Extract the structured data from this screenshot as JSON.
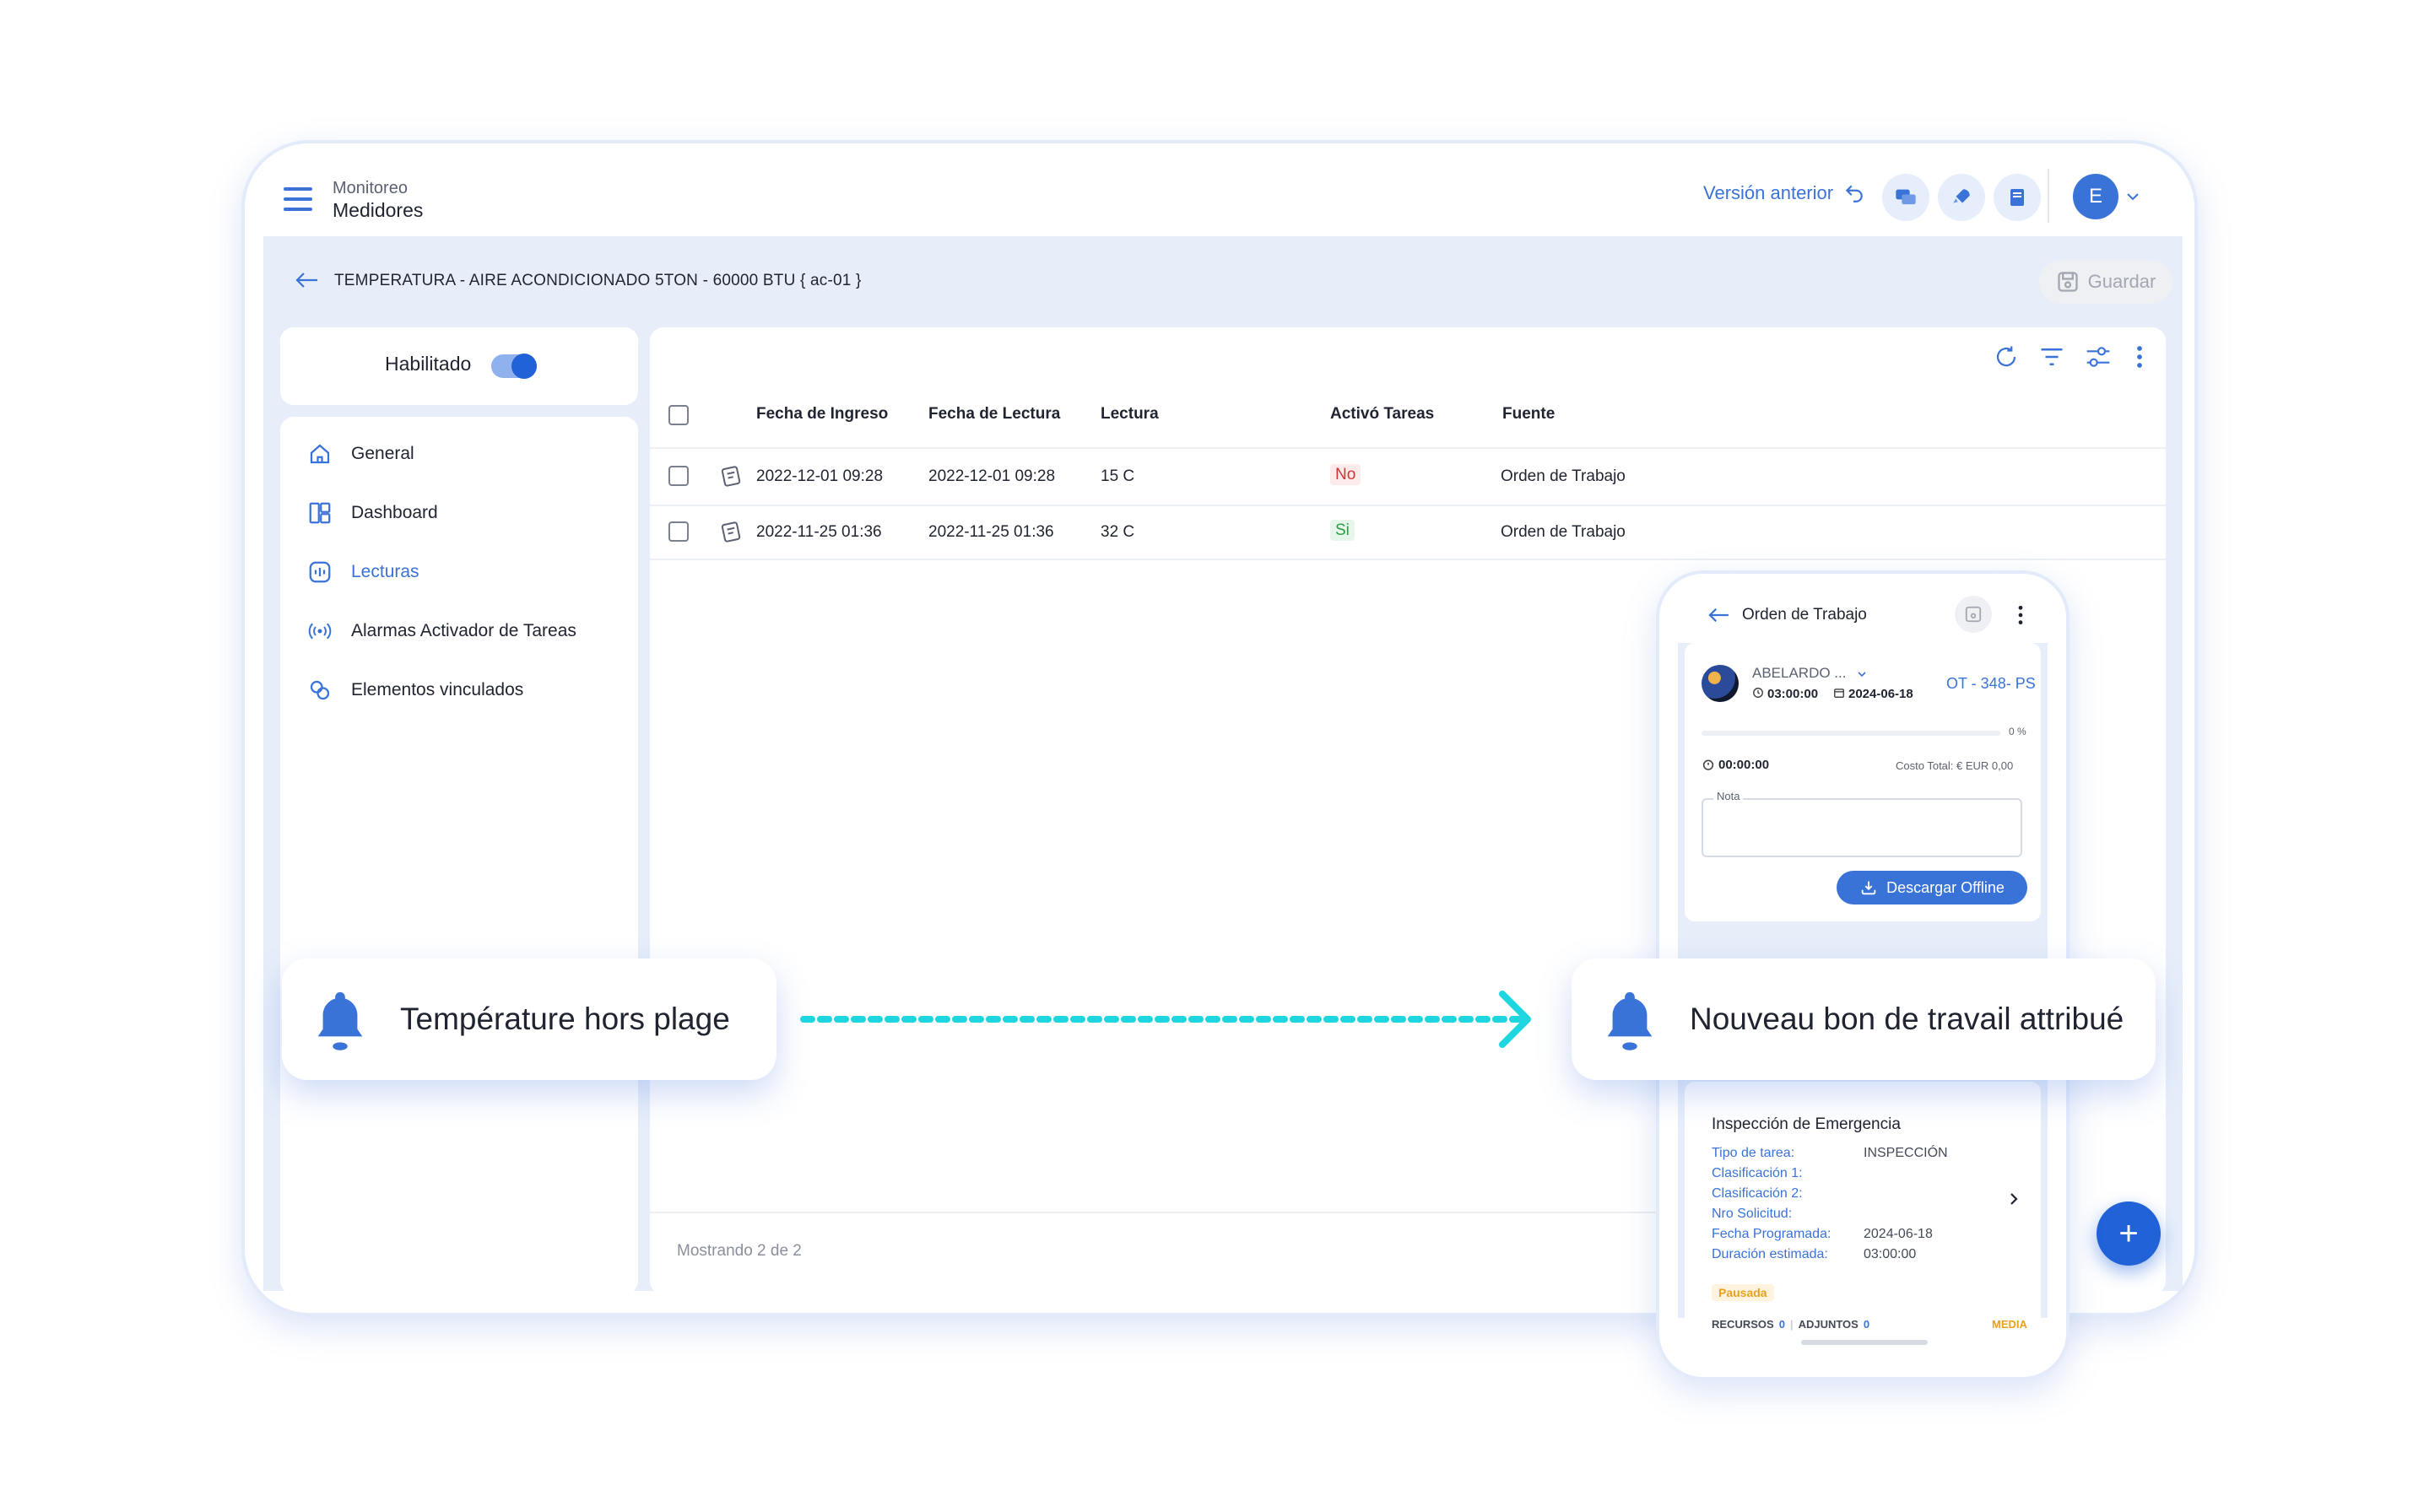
{
  "topbar": {
    "breadcrumb_section": "Monitoreo",
    "breadcrumb_page": "Medidores",
    "previous_version": "Versión anterior",
    "avatar_initial": "E"
  },
  "header": {
    "title": "TEMPERATURA - AIRE ACONDICIONADO 5TON - 60000 BTU { ac-01 }",
    "save_label": "Guardar"
  },
  "sidebar": {
    "enabled_label": "Habilitado",
    "items": [
      {
        "label": "General",
        "icon": "home-icon"
      },
      {
        "label": "Dashboard",
        "icon": "dashboard-icon"
      },
      {
        "label": "Lecturas",
        "icon": "readings-icon"
      },
      {
        "label": "Alarmas Activador de Tareas",
        "icon": "broadcast-icon"
      },
      {
        "label": "Elementos vinculados",
        "icon": "link-icon"
      }
    ]
  },
  "table": {
    "columns": [
      "Fecha de Ingreso",
      "Fecha de Lectura",
      "Lectura",
      "Activó Tareas",
      "Fuente"
    ],
    "rows": [
      {
        "ingreso": "2022-12-01 09:28",
        "lectura_fecha": "2022-12-01 09:28",
        "lectura": "15 C",
        "activo": "No",
        "fuente": "Orden de Trabajo"
      },
      {
        "ingreso": "2022-11-25 01:36",
        "lectura_fecha": "2022-11-25 01:36",
        "lectura": "32 C",
        "activo": "Si",
        "fuente": "Orden de Trabajo"
      }
    ],
    "footer": "Mostrando 2 de 2"
  },
  "phone": {
    "title": "Orden de Trabajo",
    "user": "ABELARDO ...",
    "time": "03:00:00",
    "date": "2024-06-18",
    "ot_code": "OT - 348- PS",
    "progress_pct": "0 %",
    "progress_value": 0,
    "timer": "00:00:00",
    "total_cost": "Costo Total: € EUR 0,00",
    "note_label": "Nota",
    "download_label": "Descargar Offline",
    "task_title": "Inspección de Emergencia",
    "fields": [
      {
        "label": "Tipo de tarea:",
        "value": "INSPECCIÓN"
      },
      {
        "label": "Clasificación 1:",
        "value": ""
      },
      {
        "label": "Clasificación 2:",
        "value": ""
      },
      {
        "label": "Nro Solicitud:",
        "value": ""
      },
      {
        "label": "Fecha Programada:",
        "value": "2024-06-18"
      },
      {
        "label": "Duración estimada:",
        "value": "03:00:00"
      }
    ],
    "status": "Pausada",
    "resources": "RECURSOS",
    "resources_count": "0",
    "attachments": "ADJUNTOS",
    "attachments_count": "0",
    "priority": "MEDIA"
  },
  "notifications": {
    "left": "Température hors plage",
    "right": "Nouveau bon de travail attribué"
  },
  "colors": {
    "accent": "#3a73d8",
    "notif_arrow": "#1fd6e0",
    "status_orange": "#e8a21a"
  }
}
